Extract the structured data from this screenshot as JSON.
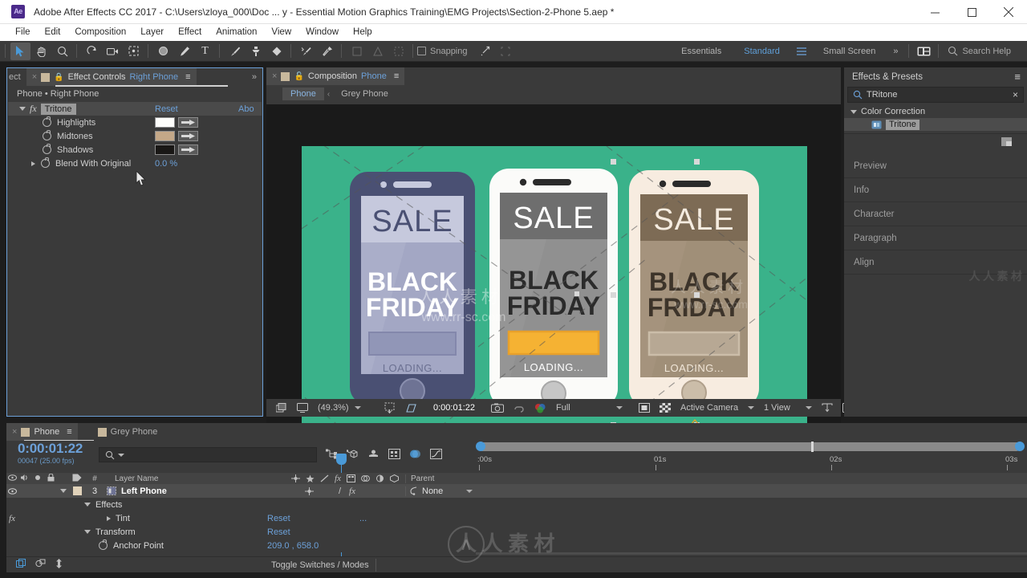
{
  "window": {
    "app_abbrev": "Ae",
    "title": "Adobe After Effects CC 2017 - C:\\Users\\zloya_000\\Doc ... y - Essential Motion Graphics Training\\EMG Projects\\Section-2-Phone 5.aep *",
    "minimize": "minimize-icon",
    "maximize": "maximize-icon",
    "close": "close-icon"
  },
  "menubar": {
    "items": [
      "File",
      "Edit",
      "Composition",
      "Layer",
      "Effect",
      "Animation",
      "View",
      "Window",
      "Help"
    ]
  },
  "toolbar": {
    "tools": [
      {
        "name": "selection-tool",
        "glyph": "➤",
        "active": true
      },
      {
        "name": "hand-tool",
        "glyph": "✋",
        "active": false
      },
      {
        "name": "zoom-tool",
        "glyph": "⌕",
        "active": false
      },
      {
        "name": "rotation-tool",
        "glyph": "↺",
        "active": false
      },
      {
        "name": "camera-tool",
        "glyph": "🎥",
        "active": false
      },
      {
        "name": "pan-behind-tool",
        "glyph": "❖",
        "active": false
      },
      {
        "name": "shape-tool",
        "glyph": "●",
        "active": false
      },
      {
        "name": "pen-tool",
        "glyph": "✒",
        "active": false
      },
      {
        "name": "type-tool",
        "glyph": "T",
        "active": false
      },
      {
        "name": "brush-tool",
        "glyph": "╱",
        "active": false
      },
      {
        "name": "clone-stamp-tool",
        "glyph": "⚓",
        "active": false
      },
      {
        "name": "eraser-tool",
        "glyph": "◆",
        "active": false
      },
      {
        "name": "roto-brush-tool",
        "glyph": "❁",
        "active": false
      },
      {
        "name": "puppet-pin-tool",
        "glyph": "✶",
        "active": false
      }
    ],
    "snapping_label": "Snapping",
    "workspaces": [
      {
        "label": "Essentials",
        "selected": false
      },
      {
        "label": "Standard",
        "selected": true
      },
      {
        "label": "Small Screen",
        "selected": false
      }
    ],
    "overflow": "»",
    "search_help_placeholder": "Search Help"
  },
  "effect_controls": {
    "tabs": [
      {
        "label": "ect",
        "active": false
      },
      {
        "label": "Effect Controls",
        "highlight": "Right Phone",
        "active": true
      }
    ],
    "breadcrumb": "Phone • Right Phone",
    "effect": {
      "name": "Tritone",
      "reset": "Reset",
      "about": "Abo"
    },
    "properties": [
      {
        "label": "Highlights",
        "type": "color",
        "color": "#fdfdfb"
      },
      {
        "label": "Midtones",
        "type": "color",
        "color": "#c4a888"
      },
      {
        "label": "Shadows",
        "type": "color",
        "color": "#191715"
      },
      {
        "label": "Blend With Original",
        "type": "value",
        "value": "0.0 %"
      }
    ]
  },
  "composition": {
    "tabs": [
      {
        "label": "Composition",
        "highlight": "Phone"
      }
    ],
    "view_tabs": [
      {
        "label": "Phone",
        "selected": true
      },
      {
        "label": "Grey Phone",
        "selected": false
      }
    ],
    "bottom_bar": {
      "magnification": "(49.3%)",
      "timecode": "0:00:01:22",
      "resolution": "Full",
      "view_mode": "Active Camera",
      "view_layout": "1 View"
    },
    "canvas": {
      "background_color": "#3ab28a",
      "phones": [
        {
          "name": "left-phone",
          "body_color": "#4a5073",
          "screen_color": "#a3a7c4",
          "banner_color": "#c6c9dd",
          "sale_text": "SALE",
          "sale_color": "#4a5073",
          "headline_line1": "BLACK",
          "headline_line2": "FRIDAY",
          "headline_color": "#ffffff",
          "bar_color": "#8e93b4",
          "loading_text": "LOADING...",
          "loading_color": "#6b7091"
        },
        {
          "name": "middle-phone",
          "body_color": "#fbfbf9",
          "screen_color": "#909090",
          "banner_color": "#6e6e6e",
          "sale_text": "SALE",
          "sale_color": "#ffffff",
          "headline_line1": "BLACK",
          "headline_line2": "FRIDAY",
          "headline_color": "#2b2b2b",
          "bar_color": "#f5b233",
          "loading_text": "LOADING...",
          "loading_color": "#ffffff"
        },
        {
          "name": "right-phone",
          "body_color": "#f7ece0",
          "screen_color": "#a08f78",
          "banner_color": "#7d6b55",
          "sale_text": "SALE",
          "sale_color": "#f5ece0",
          "headline_line1": "BLACK",
          "headline_line2": "FRIDAY",
          "headline_color": "#3d342a",
          "bar_color": "#b7a894",
          "loading_text": "LOADING...",
          "loading_color": "#f0e6d8"
        }
      ]
    }
  },
  "effects_presets": {
    "title": "Effects & Presets",
    "search_value": "TRitone",
    "search_placeholder": "Search",
    "group": "Color Correction",
    "item": "Tritone",
    "collapsed_panels": [
      "Preview",
      "Info",
      "Character",
      "Paragraph",
      "Align"
    ]
  },
  "timeline": {
    "tabs": [
      {
        "label": "Phone",
        "active": true
      },
      {
        "label": "Grey Phone",
        "active": false
      }
    ],
    "current_time": "0:00:01:22",
    "frame_info": "00047 (25.00 fps)",
    "columns": [
      "#",
      "Layer Name",
      "Parent"
    ],
    "rows": [
      {
        "indent": 0,
        "type": "layer",
        "index": "3",
        "label": "Left Phone",
        "parent": "None"
      },
      {
        "indent": 1,
        "type": "group",
        "label": "Effects"
      },
      {
        "indent": 2,
        "type": "effect",
        "label": "Tint",
        "action": "Reset",
        "extra": "..."
      },
      {
        "indent": 1,
        "type": "group",
        "label": "Transform",
        "action": "Reset"
      },
      {
        "indent": 2,
        "type": "prop",
        "label": "Anchor Point",
        "value": "209.0 , 658.0"
      }
    ],
    "ruler_ticks": [
      {
        "label": ":00s",
        "pos": 0
      },
      {
        "label": "01s",
        "pos": 222
      },
      {
        "label": "02s",
        "pos": 444
      },
      {
        "label": "03s",
        "pos": 666
      }
    ],
    "footer_label": "Toggle Switches / Modes"
  },
  "watermark": {
    "cn": "人 人 素 材",
    "url": "www.rr-sc.com"
  }
}
